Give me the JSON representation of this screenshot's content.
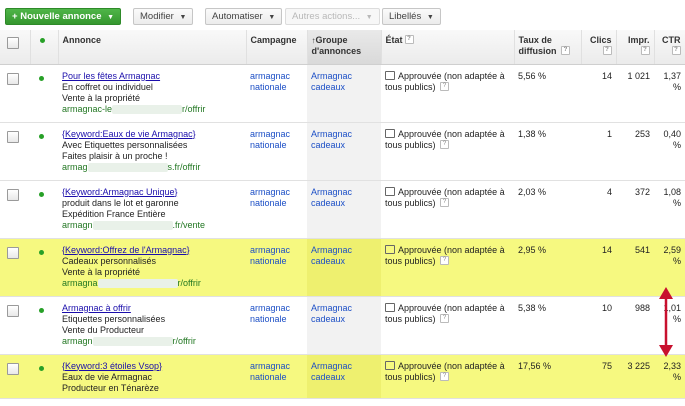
{
  "toolbar": {
    "new_ad": "Nouvelle annonce",
    "modify": "Modifier",
    "automate": "Automatiser",
    "other_actions": "Autres actions...",
    "labels": "Libellés"
  },
  "columns": {
    "ad": "Annonce",
    "campaign": "Campagne",
    "ad_group": "Groupe d'annonces",
    "status": "État",
    "impression_share": "Taux de diffusion",
    "clicks": "Clics",
    "impressions": "Impr.",
    "ctr": "CTR"
  },
  "rows": [
    {
      "title": "Pour les fêtes Armagnac",
      "line1": "En coffret ou individuel",
      "line2": "Vente à la propriété",
      "url_start": "armagnac-le",
      "url_end": "r/offrir",
      "campaign": "armagnac nationale",
      "ad_group": "Armagnac cadeaux",
      "status": "Approuvée (non adaptée à tous publics)",
      "rate": "5,56 %",
      "clicks": "14",
      "impressions": "1 021",
      "ctr": "1,37 %",
      "highlighted": false
    },
    {
      "title": "{Keyword:Eaux de vie Armagnac}",
      "line1": "Avec Etiquettes personnalisées",
      "line2": "Faites plaisir à un proche !",
      "url_start": "armag",
      "url_end": "s.fr/offrir",
      "campaign": "armagnac nationale",
      "ad_group": "Armagnac cadeaux",
      "status": "Approuvée (non adaptée à tous publics)",
      "rate": "1,38 %",
      "clicks": "1",
      "impressions": "253",
      "ctr": "0,40 %",
      "highlighted": false
    },
    {
      "title": "{Keyword:Armagnac Unique}",
      "line1": "produit dans le lot et garonne",
      "line2": "Expédition France Entière",
      "url_start": "armagn",
      "url_end": ".fr/vente",
      "campaign": "armagnac nationale",
      "ad_group": "Armagnac cadeaux",
      "status": "Approuvée (non adaptée à tous publics)",
      "rate": "2,03 %",
      "clicks": "4",
      "impressions": "372",
      "ctr": "1,08 %",
      "highlighted": false
    },
    {
      "title": "{Keyword:Offrez de l'Armagnac}",
      "line1": "Cadeaux personnalisés",
      "line2": "Vente à la propriété",
      "url_start": "armagna",
      "url_end": "r/offrir",
      "campaign": "armagnac nationale",
      "ad_group": "Armagnac cadeaux",
      "status": "Approuvée (non adaptée à tous publics)",
      "rate": "2,95 %",
      "clicks": "14",
      "impressions": "541",
      "ctr": "2,59 %",
      "highlighted": true
    },
    {
      "title": "Armagnac à offrir",
      "line1": "Etiquettes personnalisées",
      "line2": "Vente du Producteur",
      "url_start": "armagn",
      "url_end": "r/offrir",
      "campaign": "armagnac nationale",
      "ad_group": "Armagnac cadeaux",
      "status": "Approuvée (non adaptée à tous publics)",
      "rate": "5,38 %",
      "clicks": "10",
      "impressions": "988",
      "ctr": "1,01 %",
      "highlighted": false
    },
    {
      "title": "{Keyword:3 étoiles Vsop}",
      "line1": "Eaux de vie Armagnac",
      "line2": "Producteur en Ténarèze",
      "url_start": "",
      "url_end": "",
      "campaign": "armagnac nationale",
      "ad_group": "Armagnac cadeaux",
      "status": "Approuvée (non adaptée à tous publics)",
      "rate": "17,56 %",
      "clicks": "75",
      "impressions": "3 225",
      "ctr": "2,33 %",
      "highlighted": true
    }
  ],
  "colors": {
    "highlight": "#f6f980",
    "primary_button": "#3aa434",
    "link": "#1a0dab",
    "url": "#227722",
    "annotation_arrow": "#c8102e"
  }
}
